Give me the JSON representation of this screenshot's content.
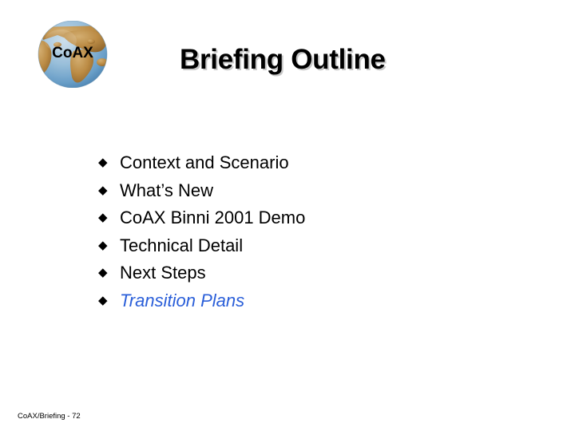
{
  "slide": {
    "title": "Briefing Outline",
    "background_color": "#FFFFFF",
    "title_shadow_color": "#C8C8C8"
  },
  "logo": {
    "name": "coax-globe-logo",
    "label": "CoAX",
    "land_color": "#C8954A",
    "ocean_color": "#8FBCE0",
    "text_color": "#000000"
  },
  "outline": {
    "bullet_glyph": "◆",
    "bullet_color": "#000000",
    "accent_color": "#2B5FD9",
    "items": [
      {
        "label": "Context and Scenario",
        "accent": false
      },
      {
        "label": "What’s New",
        "accent": false
      },
      {
        "label": "CoAX Binni 2001 Demo",
        "accent": false
      },
      {
        "label": "Technical Detail",
        "accent": false
      },
      {
        "label": "Next Steps",
        "accent": false
      },
      {
        "label": "Transition Plans",
        "accent": true
      }
    ]
  },
  "footer": {
    "text": "CoAX/Briefing - 72"
  }
}
